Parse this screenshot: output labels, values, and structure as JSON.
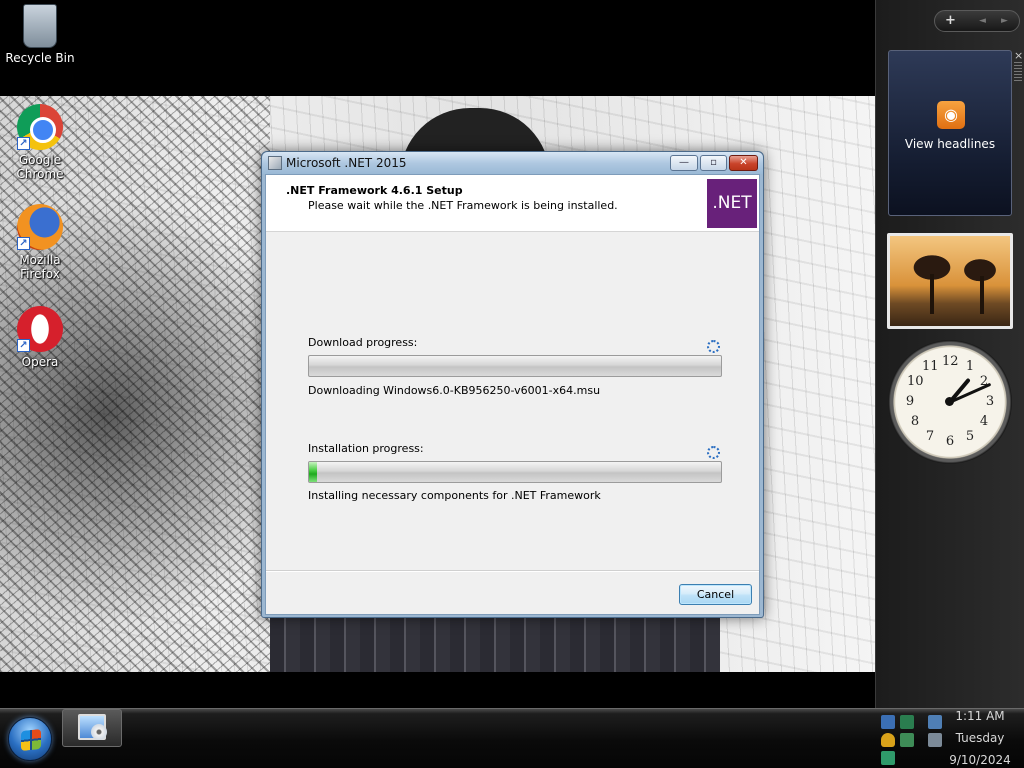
{
  "desktop": {
    "icons": [
      {
        "label": "Recycle Bin",
        "icon": "recycle-bin-icon"
      },
      {
        "label": "Google Chrome",
        "icon": "chrome-icon"
      },
      {
        "label": "Mozilla Firefox",
        "icon": "firefox-icon"
      },
      {
        "label": "Opera",
        "icon": "opera-icon"
      }
    ],
    "shortcut_arrow": "↗"
  },
  "sidebar": {
    "add_glyph": "+",
    "prev_glyph": "◄",
    "next_glyph": "►",
    "feed_gadget": {
      "label": "View headlines",
      "icon": "rss-icon",
      "icon_glyph": "◉",
      "close_glyph": "×"
    },
    "slideshow_gadget": {
      "icon": "tree-photo"
    },
    "clock": {
      "time_shown": "1:11",
      "numbers": [
        "12",
        "1",
        "2",
        "3",
        "4",
        "5",
        "6",
        "7",
        "8",
        "9",
        "10",
        "11"
      ]
    }
  },
  "dialog": {
    "title": "Microsoft .NET 2015",
    "heading": ".NET Framework 4.6.1 Setup",
    "subheading": "Please wait while the .NET Framework is being installed.",
    "logo_text": ".NET",
    "caption_buttons": {
      "minimize": "—",
      "maximize": "▫",
      "close": "✕"
    },
    "download": {
      "label": "Download progress:",
      "progress": 0.0,
      "status": "Downloading Windows6.0-KB956250-v6001-x64.msu"
    },
    "install": {
      "label": "Installation progress:",
      "progress": 0.02,
      "status": "Installing necessary components for .NET Framework"
    },
    "cancel_label": "Cancel",
    "colors": {
      "net_purple": "#68217a",
      "progress_green": "#1faa1f"
    }
  },
  "taskbar": {
    "clock_time": "1:11 AM",
    "clock_day": "Tuesday",
    "clock_date": "9/10/2024",
    "tray_icons": [
      "monitor-icon",
      "network-icon",
      "security-shield-icon",
      "action-center-icon",
      "connection-icon",
      "volume-muted-icon",
      "sync-icon"
    ]
  }
}
